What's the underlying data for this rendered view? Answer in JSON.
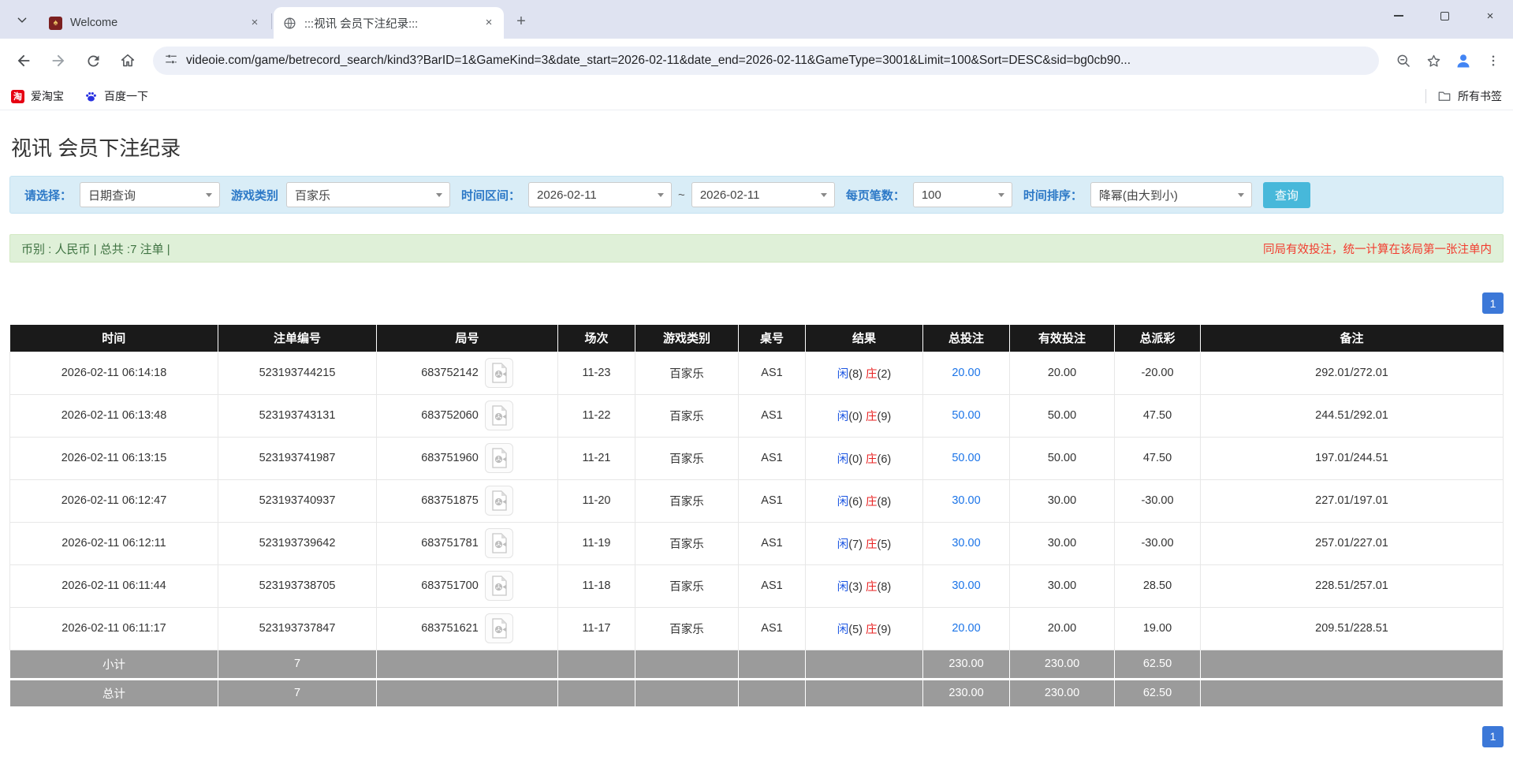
{
  "colors": {
    "accent_blue": "#1b74e8",
    "negative_red": "#f00000",
    "banker_red": "#e82222",
    "player_blue": "#1b55e2",
    "filter_bg": "#d9edf7",
    "filter_label": "#2d79c7",
    "summary_bg": "#dff0d8",
    "search_btn": "#47b8da",
    "header_bg": "#1a1a1a",
    "footer_bg": "#9b9b9b",
    "pagination_blue": "#3c78d8"
  },
  "browser": {
    "tab1": {
      "title": "Welcome",
      "favicon_glyph": "♠"
    },
    "tab2": {
      "title": ":::视讯 会员下注纪录:::"
    },
    "url": "videoie.com/game/betrecord_search/kind3?BarID=1&GameKind=3&date_start=2026-02-11&date_end=2026-02-11&GameType=3001&Limit=100&Sort=DESC&sid=bg0cb90...",
    "close_glyph": "×",
    "bookmarks": {
      "item1": "爱淘宝",
      "item1_icon_glyph": "淘",
      "item2": "百度一下",
      "all_bookmarks": "所有书签"
    }
  },
  "page": {
    "title": "视讯 会员下注纪录",
    "filters": {
      "select_label": "请选择：",
      "select_value": "日期查询",
      "game_kind_label": "游戏类别",
      "game_kind_value": "百家乐",
      "date_range_label": "时间区间：",
      "date_start": "2026-02-11",
      "tilde": "~",
      "date_end": "2026-02-11",
      "per_page_label": "每页笔数：",
      "per_page_value": "100",
      "sort_label": "时间排序：",
      "sort_value": "降幂(由大到小)",
      "search_button": "查询"
    },
    "summary": {
      "left": "币别 : 人民币 | 总共 :7 注单 |",
      "right": "同局有效投注，统一计算在该局第一张注单内"
    },
    "pagination": "1",
    "table": {
      "headers": [
        "时间",
        "注单编号",
        "局号",
        "场次",
        "游戏类别",
        "桌号",
        "结果",
        "总投注",
        "有效投注",
        "总派彩",
        "备注"
      ],
      "rows": [
        {
          "time": "2026-02-11 06:14:18",
          "bet_id": "523193744215",
          "round": "683752142",
          "session": "11-23",
          "game": "百家乐",
          "table_no": "AS1",
          "result": {
            "player_label": "闲",
            "player_score": "(8)",
            "banker_label": "庄",
            "banker_score": "(2)"
          },
          "total_bet": "20.00",
          "valid_bet": "20.00",
          "payout": "-20.00",
          "note": "292.01/272.01"
        },
        {
          "time": "2026-02-11 06:13:48",
          "bet_id": "523193743131",
          "round": "683752060",
          "session": "11-22",
          "game": "百家乐",
          "table_no": "AS1",
          "result": {
            "player_label": "闲",
            "player_score": "(0)",
            "banker_label": "庄",
            "banker_score": "(9)"
          },
          "total_bet": "50.00",
          "valid_bet": "50.00",
          "payout": "47.50",
          "note": "244.51/292.01"
        },
        {
          "time": "2026-02-11 06:13:15",
          "bet_id": "523193741987",
          "round": "683751960",
          "session": "11-21",
          "game": "百家乐",
          "table_no": "AS1",
          "result": {
            "player_label": "闲",
            "player_score": "(0)",
            "banker_label": "庄",
            "banker_score": "(6)"
          },
          "total_bet": "50.00",
          "valid_bet": "50.00",
          "payout": "47.50",
          "note": "197.01/244.51"
        },
        {
          "time": "2026-02-11 06:12:47",
          "bet_id": "523193740937",
          "round": "683751875",
          "session": "11-20",
          "game": "百家乐",
          "table_no": "AS1",
          "result": {
            "player_label": "闲",
            "player_score": "(6)",
            "banker_label": "庄",
            "banker_score": "(8)"
          },
          "total_bet": "30.00",
          "valid_bet": "30.00",
          "payout": "-30.00",
          "note": "227.01/197.01"
        },
        {
          "time": "2026-02-11 06:12:11",
          "bet_id": "523193739642",
          "round": "683751781",
          "session": "11-19",
          "game": "百家乐",
          "table_no": "AS1",
          "result": {
            "player_label": "闲",
            "player_score": "(7)",
            "banker_label": "庄",
            "banker_score": "(5)"
          },
          "total_bet": "30.00",
          "valid_bet": "30.00",
          "payout": "-30.00",
          "note": "257.01/227.01"
        },
        {
          "time": "2026-02-11 06:11:44",
          "bet_id": "523193738705",
          "round": "683751700",
          "session": "11-18",
          "game": "百家乐",
          "table_no": "AS1",
          "result": {
            "player_label": "闲",
            "player_score": "(3)",
            "banker_label": "庄",
            "banker_score": "(8)"
          },
          "total_bet": "30.00",
          "valid_bet": "30.00",
          "payout": "28.50",
          "note": "228.51/257.01"
        },
        {
          "time": "2026-02-11 06:11:17",
          "bet_id": "523193737847",
          "round": "683751621",
          "session": "11-17",
          "game": "百家乐",
          "table_no": "AS1",
          "result": {
            "player_label": "闲",
            "player_score": "(5)",
            "banker_label": "庄",
            "banker_score": "(9)"
          },
          "total_bet": "20.00",
          "valid_bet": "20.00",
          "payout": "19.00",
          "note": "209.51/228.51"
        }
      ],
      "subtotal": {
        "label": "小计",
        "count": "7",
        "total_bet": "230.00",
        "valid_bet": "230.00",
        "payout": "62.50"
      },
      "total": {
        "label": "总计",
        "count": "7",
        "total_bet": "230.00",
        "valid_bet": "230.00",
        "payout": "62.50"
      }
    }
  }
}
